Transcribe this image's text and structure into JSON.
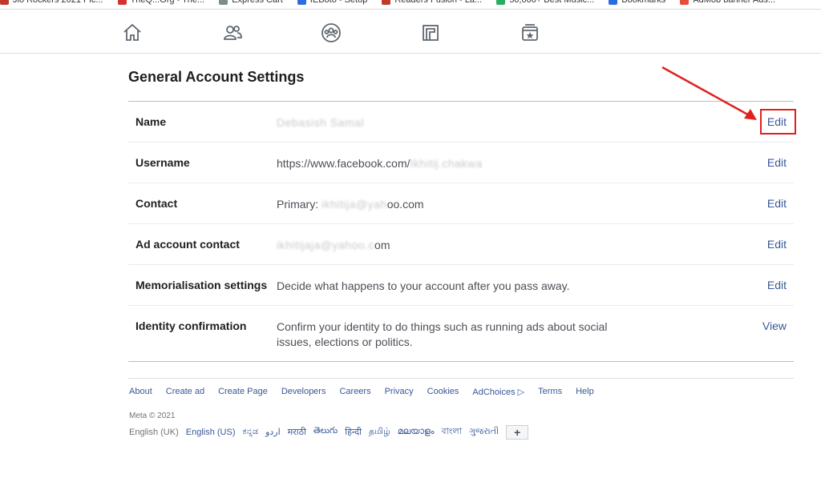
{
  "bookmarks": [
    {
      "label": "Jio Rockers 2021 Pic...",
      "color": "#c0392b"
    },
    {
      "label": "TheQ...Org - The...",
      "color": "#d63031"
    },
    {
      "label": "Express Cart",
      "color": "#7f8c8d"
    },
    {
      "label": "IEBoto - Setup",
      "color": "#2d6cdf"
    },
    {
      "label": "Readers Fusion - La...",
      "color": "#c0392b"
    },
    {
      "label": "50,000+ Best Music...",
      "color": "#27ae60"
    },
    {
      "label": "Bookmarks",
      "color": "#2d6cdf"
    },
    {
      "label": "AdMob banner Ads...",
      "color": "#e74c3c"
    }
  ],
  "nav": {
    "icons": [
      "home-icon",
      "friends-icon",
      "groups-icon",
      "pages-icon",
      "saved-icon"
    ]
  },
  "settings": {
    "title": "General Account Settings",
    "rows": [
      {
        "label": "Name",
        "value": "Debasish Samal",
        "action": "Edit",
        "blurred": true
      },
      {
        "label": "Username",
        "value": "https://www.facebook.com/",
        "value_blur": "Ikhitij.chakwa",
        "action": "Edit"
      },
      {
        "label": "Contact",
        "value": "Primary: ",
        "value_blur": "ikhitija@yah",
        "value_tail": "oo.com",
        "action": "Edit"
      },
      {
        "label": "Ad account contact",
        "value": "",
        "value_blur": "ikhitijaja@yahoo.c",
        "value_tail": "om",
        "action": "Edit"
      },
      {
        "label": "Memorialisation settings",
        "value": "Decide what happens to your account after you pass away.",
        "action": "Edit"
      },
      {
        "label": "Identity confirmation",
        "value": "Confirm your identity to do things such as running ads about social issues, elections or politics.",
        "action": "View"
      }
    ]
  },
  "footer": {
    "links": [
      "About",
      "Create ad",
      "Create Page",
      "Developers",
      "Careers",
      "Privacy",
      "Cookies",
      "AdChoices",
      "Terms",
      "Help"
    ],
    "copyright": "Meta © 2021",
    "current_language": "English (UK)",
    "languages": [
      "English (US)",
      "ಕನ್ನಡ",
      "اردو",
      "मराठी",
      "తెలుగు",
      "हिन्दी",
      "தமிழ்",
      "മലയാളം",
      "বাংলা",
      "ગુજરાતી"
    ],
    "more_button": "+"
  },
  "colors": {
    "link": "#385898",
    "annotation": "#e02020"
  }
}
